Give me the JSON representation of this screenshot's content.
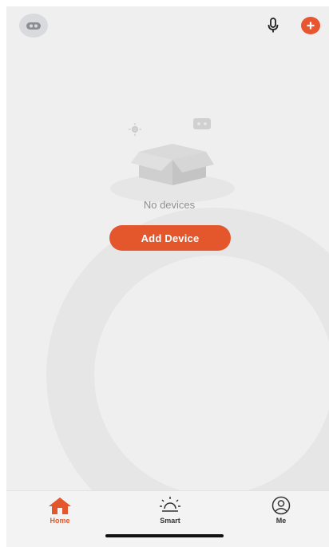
{
  "empty_state": {
    "message": "No devices",
    "button_label": "Add Device"
  },
  "tabbar": {
    "items": [
      {
        "label": "Home",
        "icon": "home-icon",
        "active": true
      },
      {
        "label": "Smart",
        "icon": "sun-icon",
        "active": false
      },
      {
        "label": "Me",
        "icon": "user-icon",
        "active": false
      }
    ]
  },
  "colors": {
    "accent": "#e4562c",
    "background": "#efefef",
    "tabbar_background": "#f3f3f3"
  }
}
